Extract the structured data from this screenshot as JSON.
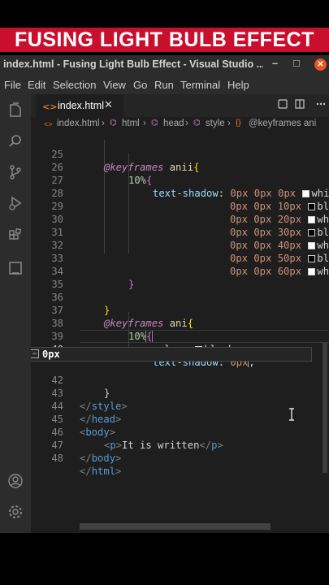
{
  "banner": {
    "text": "FUSING LIGHT BULB EFFECT"
  },
  "window": {
    "title": "index.html - Fusing Light Bulb Effect - Visual Studio ...",
    "controls": {
      "minimize": "–",
      "maximize": "□",
      "close": "✕"
    }
  },
  "menu": [
    "File",
    "Edit",
    "Selection",
    "View",
    "Go",
    "Run",
    "Terminal",
    "Help"
  ],
  "tab": {
    "label": "index.html",
    "icon": "<>",
    "close": "✕"
  },
  "breadcrumbs": [
    "index.html",
    "html",
    "head",
    "style",
    "@keyframes ani"
  ],
  "editor": {
    "suggestion": "0px",
    "lines": [
      {
        "n": "25",
        "text": "@keyframes anii{"
      },
      {
        "n": "26",
        "text": "10%{"
      },
      {
        "n": "27",
        "text": "text-shadow: 0px 0px 0px whi"
      },
      {
        "n": "28",
        "text": "0px 0px 10px bl"
      },
      {
        "n": "29",
        "text": "0px 0px 20px wh"
      },
      {
        "n": "30",
        "text": "0px 0px 30px bl"
      },
      {
        "n": "31",
        "text": "0px 0px 40px wh"
      },
      {
        "n": "32",
        "text": "0px 0px 50px bl"
      },
      {
        "n": "33",
        "text": "0px 0px 60px wh"
      },
      {
        "n": "34",
        "text": "}"
      },
      {
        "n": "35",
        "text": ""
      },
      {
        "n": "36",
        "text": "}"
      },
      {
        "n": "37",
        "text": "@keyframes ani{"
      },
      {
        "n": "38",
        "text": "10%{"
      },
      {
        "n": "39",
        "text": "color: black;"
      },
      {
        "n": "40",
        "text": "text-shadow: 0px;"
      },
      {
        "n": "42",
        "text": "}"
      },
      {
        "n": "43",
        "text": "</style>"
      },
      {
        "n": "44",
        "text": "</head>"
      },
      {
        "n": "45",
        "text": "<body>"
      },
      {
        "n": "46",
        "text": "<p>It is written</p>"
      },
      {
        "n": "47",
        "text": "</body>"
      },
      {
        "n": "48",
        "text": "</html>"
      }
    ]
  },
  "colors": {
    "banner_red": "#c8102e",
    "close_orange": "#e95420",
    "editor_bg": "#1e1e1e"
  },
  "icons": [
    "explorer-icon",
    "search-icon",
    "source-control-icon",
    "run-debug-icon",
    "extensions-icon",
    "remote-icon",
    "account-icon",
    "settings-gear-icon",
    "html-file-icon",
    "split-editor-icon",
    "more-actions-icon"
  ]
}
